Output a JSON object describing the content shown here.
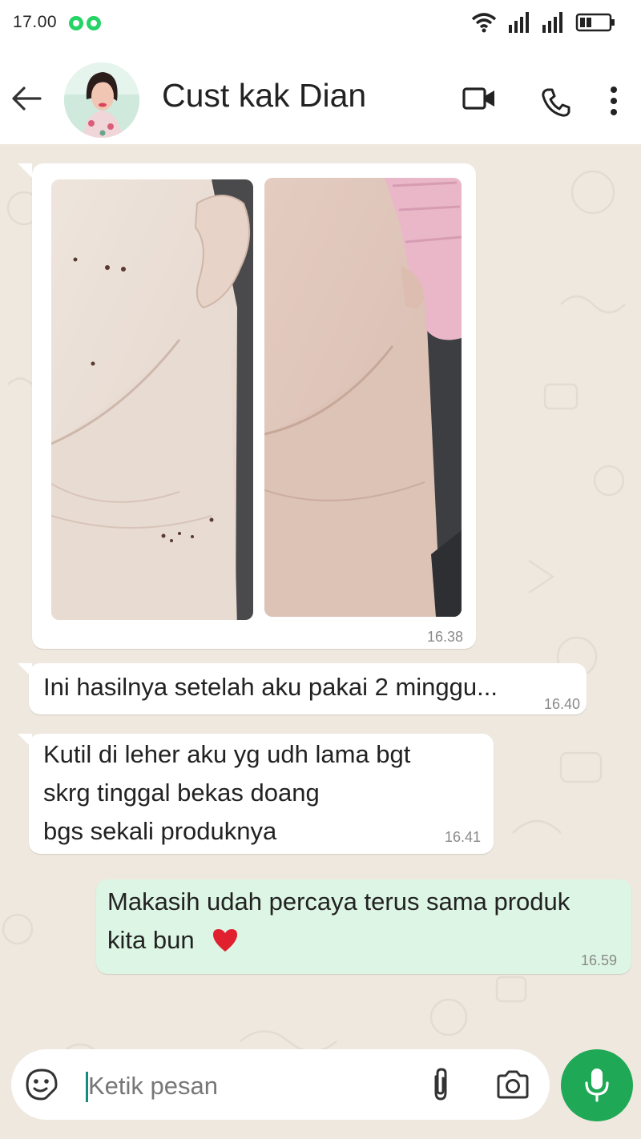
{
  "status_bar": {
    "time": "17.00",
    "notification_icons": [
      "whatsapp-icon",
      "whatsapp-icon"
    ],
    "right_icons": [
      "wifi-icon",
      "signal-icon",
      "signal-icon",
      "battery-icon"
    ]
  },
  "header": {
    "contact_name": "Cust kak Dian",
    "icons": [
      "back-arrow-icon",
      "video-call-icon",
      "phone-icon",
      "more-vert-icon"
    ]
  },
  "messages": [
    {
      "direction": "incoming",
      "type": "image",
      "images": [
        "neck-before-photo",
        "neck-after-photo"
      ],
      "time": "16.38"
    },
    {
      "direction": "incoming",
      "type": "text",
      "lines": [
        "Ini hasilnya setelah aku pakai 2 minggu..."
      ],
      "time": "16.40"
    },
    {
      "direction": "incoming",
      "type": "text",
      "lines": [
        "Kutil di leher aku yg udh lama bgt",
        "skrg tinggal bekas doang",
        "bgs sekali produknya"
      ],
      "time": "16.41"
    },
    {
      "direction": "outgoing",
      "type": "text",
      "lines": [
        "Makasih udah percaya terus sama produk",
        "kita bun"
      ],
      "emoji": "heart-emoji",
      "time": "16.59"
    }
  ],
  "composer": {
    "placeholder": "Ketik pesan",
    "icons": [
      "emoji-sticker-icon",
      "attach-icon",
      "camera-icon",
      "mic-icon"
    ]
  },
  "colors": {
    "accent_green": "#1fa855",
    "outgoing_bubble": "#dcf5e4",
    "chat_background": "#eee8df",
    "heart": "#e0202f"
  }
}
